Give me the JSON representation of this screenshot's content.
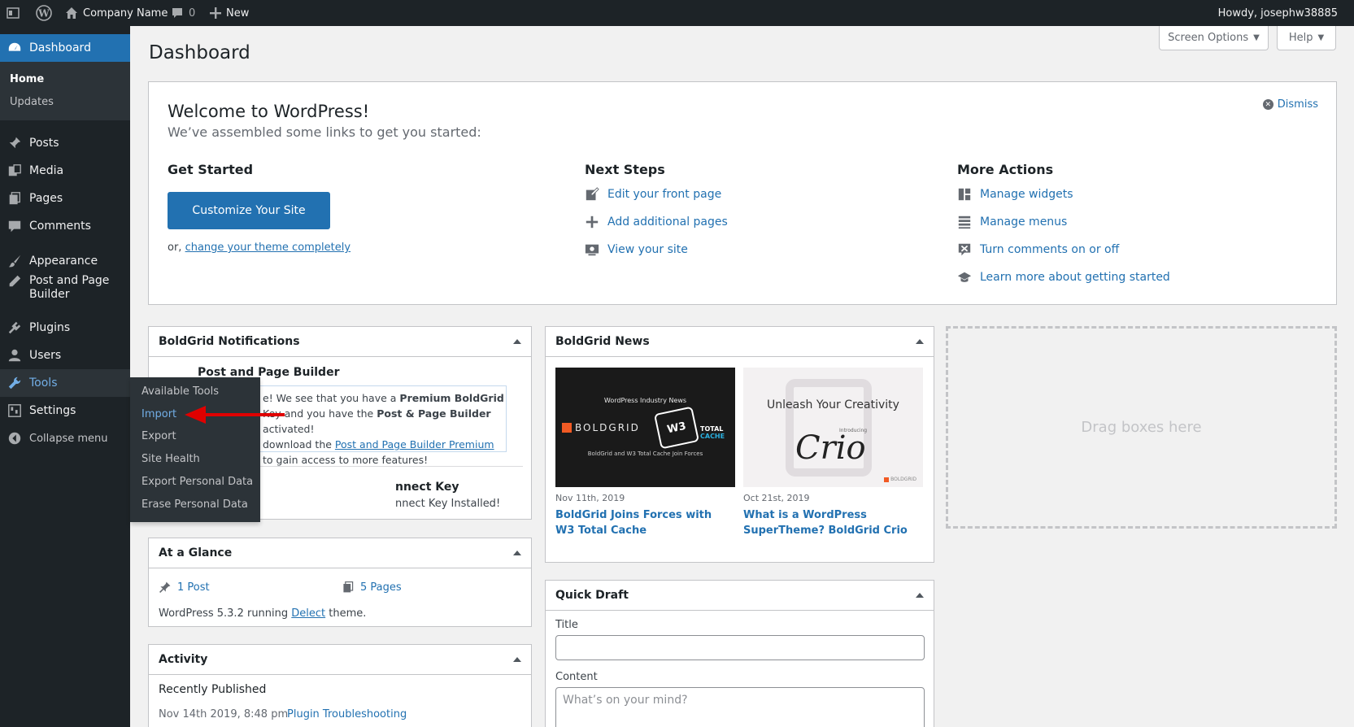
{
  "adminbar": {
    "site_name": "Company Name",
    "comments_count": "0",
    "new_label": "New",
    "howdy": "Howdy, josephw38885"
  },
  "sidebar": {
    "dashboard": "Dashboard",
    "home": "Home",
    "updates": "Updates",
    "posts": "Posts",
    "media": "Media",
    "pages": "Pages",
    "comments": "Comments",
    "appearance": "Appearance",
    "page_builder_1": "Post and Page",
    "page_builder_2": "Builder",
    "plugins": "Plugins",
    "users": "Users",
    "tools": "Tools",
    "settings": "Settings",
    "collapse": "Collapse menu"
  },
  "tools_flyout": [
    "Available Tools",
    "Import",
    "Export",
    "Site Health",
    "Export Personal Data",
    "Erase Personal Data"
  ],
  "top_buttons": {
    "screen_options": "Screen Options",
    "help": "Help"
  },
  "page_title": "Dashboard",
  "welcome": {
    "title": "Welcome to WordPress!",
    "subtitle": "We’ve assembled some links to get you started:",
    "dismiss": "Dismiss",
    "get_started": "Get Started",
    "customize_button": "Customize Your Site",
    "or_text": "or,",
    "change_theme": "change your theme completely",
    "next_steps": "Next Steps",
    "next_links": [
      "Edit your front page",
      "Add additional pages",
      "View your site"
    ],
    "more_actions": "More Actions",
    "more_links": [
      "Manage widgets",
      "Manage menus",
      "Turn comments on or off",
      "Learn more about getting started"
    ]
  },
  "boldgrid_notifications": {
    "title": "BoldGrid Notifications",
    "item1_title": "Post and Page Builder",
    "line1a": "e! We see that you have a ",
    "line1b": "Premium BoldGrid",
    "line2a": "Key and you have the ",
    "line2b": "Post & Page Builder",
    "line2c": " activated!",
    "line3a": "download the ",
    "line3b": "Post and Page Builder Premium",
    "line4": "to gain access to more features!",
    "item2_title": "nnect Key",
    "item2_text": "nnect Key Installed!"
  },
  "at_a_glance": {
    "title": "At a Glance",
    "posts": "1 Post",
    "pages": "5 Pages",
    "running_a": "WordPress 5.3.2 running ",
    "theme": "Delect",
    "running_b": " theme."
  },
  "activity": {
    "title": "Activity",
    "recently_published": "Recently Published",
    "date": "Nov 14th 2019, 8:48 pm",
    "post_title": "Plugin Troubleshooting"
  },
  "boldgrid_news": {
    "title": "BoldGrid News",
    "img1_header": "WordPress Industry News",
    "img1_brand": "BOLDGRID",
    "img1_w3": "W3",
    "img1_total": "TOTAL",
    "img1_cache": "CACHE",
    "img1_caption": "BoldGrid and W3 Total Cache Join Forces",
    "img2_header": "Unleash Your Creativity",
    "img2_intro": "Introducing",
    "img2_logo": "Crio",
    "img2_brand": "BOLDGRID",
    "date1": "Nov 11th, 2019",
    "link1": "BoldGrid Joins Forces with W3 Total Cache",
    "date2": "Oct 21st, 2019",
    "link2": "What is a WordPress SuperTheme? BoldGrid Crio"
  },
  "quick_draft": {
    "title": "Quick Draft",
    "title_label": "Title",
    "content_label": "Content",
    "content_placeholder": "What’s on your mind?"
  },
  "drag_boxes": "Drag boxes here",
  "colors": {
    "accent": "#2271b1",
    "adminbar": "#1d2327",
    "annotation_arrow": "#e00000"
  }
}
